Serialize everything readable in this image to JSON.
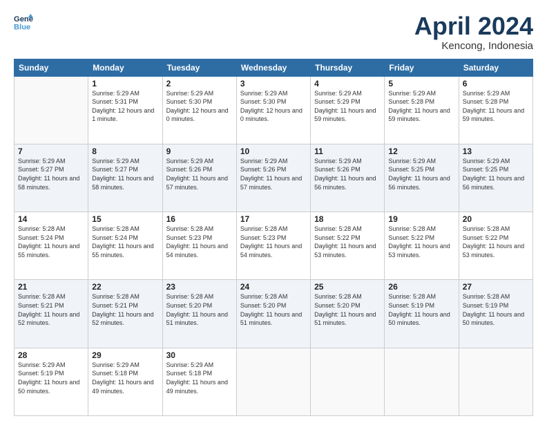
{
  "header": {
    "logo_line1": "General",
    "logo_line2": "Blue",
    "month": "April 2024",
    "location": "Kencong, Indonesia"
  },
  "days_of_week": [
    "Sunday",
    "Monday",
    "Tuesday",
    "Wednesday",
    "Thursday",
    "Friday",
    "Saturday"
  ],
  "weeks": [
    [
      {
        "num": "",
        "empty": true
      },
      {
        "num": "1",
        "sunrise": "5:29 AM",
        "sunset": "5:31 PM",
        "daylight": "12 hours and 1 minute."
      },
      {
        "num": "2",
        "sunrise": "5:29 AM",
        "sunset": "5:30 PM",
        "daylight": "12 hours and 0 minutes."
      },
      {
        "num": "3",
        "sunrise": "5:29 AM",
        "sunset": "5:30 PM",
        "daylight": "12 hours and 0 minutes."
      },
      {
        "num": "4",
        "sunrise": "5:29 AM",
        "sunset": "5:29 PM",
        "daylight": "11 hours and 59 minutes."
      },
      {
        "num": "5",
        "sunrise": "5:29 AM",
        "sunset": "5:28 PM",
        "daylight": "11 hours and 59 minutes."
      },
      {
        "num": "6",
        "sunrise": "5:29 AM",
        "sunset": "5:28 PM",
        "daylight": "11 hours and 59 minutes."
      }
    ],
    [
      {
        "num": "7",
        "sunrise": "5:29 AM",
        "sunset": "5:27 PM",
        "daylight": "11 hours and 58 minutes."
      },
      {
        "num": "8",
        "sunrise": "5:29 AM",
        "sunset": "5:27 PM",
        "daylight": "11 hours and 58 minutes."
      },
      {
        "num": "9",
        "sunrise": "5:29 AM",
        "sunset": "5:26 PM",
        "daylight": "11 hours and 57 minutes."
      },
      {
        "num": "10",
        "sunrise": "5:29 AM",
        "sunset": "5:26 PM",
        "daylight": "11 hours and 57 minutes."
      },
      {
        "num": "11",
        "sunrise": "5:29 AM",
        "sunset": "5:26 PM",
        "daylight": "11 hours and 56 minutes."
      },
      {
        "num": "12",
        "sunrise": "5:29 AM",
        "sunset": "5:25 PM",
        "daylight": "11 hours and 56 minutes."
      },
      {
        "num": "13",
        "sunrise": "5:29 AM",
        "sunset": "5:25 PM",
        "daylight": "11 hours and 56 minutes."
      }
    ],
    [
      {
        "num": "14",
        "sunrise": "5:28 AM",
        "sunset": "5:24 PM",
        "daylight": "11 hours and 55 minutes."
      },
      {
        "num": "15",
        "sunrise": "5:28 AM",
        "sunset": "5:24 PM",
        "daylight": "11 hours and 55 minutes."
      },
      {
        "num": "16",
        "sunrise": "5:28 AM",
        "sunset": "5:23 PM",
        "daylight": "11 hours and 54 minutes."
      },
      {
        "num": "17",
        "sunrise": "5:28 AM",
        "sunset": "5:23 PM",
        "daylight": "11 hours and 54 minutes."
      },
      {
        "num": "18",
        "sunrise": "5:28 AM",
        "sunset": "5:22 PM",
        "daylight": "11 hours and 53 minutes."
      },
      {
        "num": "19",
        "sunrise": "5:28 AM",
        "sunset": "5:22 PM",
        "daylight": "11 hours and 53 minutes."
      },
      {
        "num": "20",
        "sunrise": "5:28 AM",
        "sunset": "5:22 PM",
        "daylight": "11 hours and 53 minutes."
      }
    ],
    [
      {
        "num": "21",
        "sunrise": "5:28 AM",
        "sunset": "5:21 PM",
        "daylight": "11 hours and 52 minutes."
      },
      {
        "num": "22",
        "sunrise": "5:28 AM",
        "sunset": "5:21 PM",
        "daylight": "11 hours and 52 minutes."
      },
      {
        "num": "23",
        "sunrise": "5:28 AM",
        "sunset": "5:20 PM",
        "daylight": "11 hours and 51 minutes."
      },
      {
        "num": "24",
        "sunrise": "5:28 AM",
        "sunset": "5:20 PM",
        "daylight": "11 hours and 51 minutes."
      },
      {
        "num": "25",
        "sunrise": "5:28 AM",
        "sunset": "5:20 PM",
        "daylight": "11 hours and 51 minutes."
      },
      {
        "num": "26",
        "sunrise": "5:28 AM",
        "sunset": "5:19 PM",
        "daylight": "11 hours and 50 minutes."
      },
      {
        "num": "27",
        "sunrise": "5:28 AM",
        "sunset": "5:19 PM",
        "daylight": "11 hours and 50 minutes."
      }
    ],
    [
      {
        "num": "28",
        "sunrise": "5:29 AM",
        "sunset": "5:19 PM",
        "daylight": "11 hours and 50 minutes."
      },
      {
        "num": "29",
        "sunrise": "5:29 AM",
        "sunset": "5:18 PM",
        "daylight": "11 hours and 49 minutes."
      },
      {
        "num": "30",
        "sunrise": "5:29 AM",
        "sunset": "5:18 PM",
        "daylight": "11 hours and 49 minutes."
      },
      {
        "num": "",
        "empty": true
      },
      {
        "num": "",
        "empty": true
      },
      {
        "num": "",
        "empty": true
      },
      {
        "num": "",
        "empty": true
      }
    ]
  ]
}
